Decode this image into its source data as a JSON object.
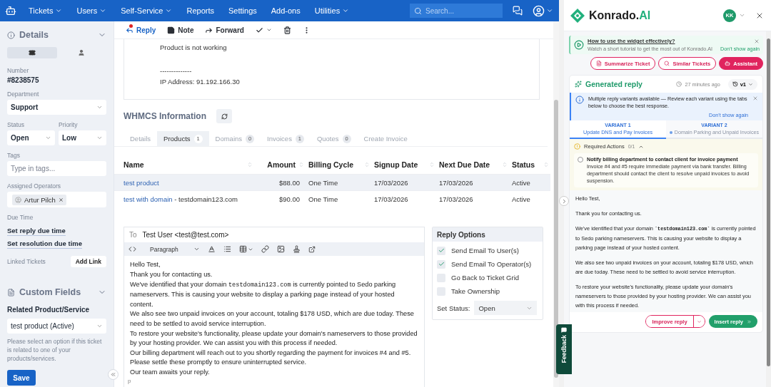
{
  "nav": {
    "items": [
      {
        "label": "Tickets",
        "dropdown": true
      },
      {
        "label": "Users",
        "dropdown": true
      },
      {
        "label": "Self-Service",
        "dropdown": true
      },
      {
        "label": "Reports",
        "dropdown": false
      },
      {
        "label": "Settings",
        "dropdown": false
      },
      {
        "label": "Add-ons",
        "dropdown": false
      },
      {
        "label": "Utilities",
        "dropdown": true
      }
    ],
    "search": {
      "placeholder": "Search..."
    }
  },
  "sidebar": {
    "details": {
      "title": "Details",
      "view_tabs": [
        {
          "kind": "ticket",
          "selected": true
        },
        {
          "kind": "user",
          "selected": false
        }
      ],
      "number_label": "Number",
      "number": "#8238575",
      "department_label": "Department",
      "department": "Support",
      "status_label": "Status",
      "status": "Open",
      "priority_label": "Priority",
      "priority": "Low",
      "tags_label": "Tags",
      "tags_placeholder": "Type in tags...",
      "operators_label": "Assigned Operators",
      "operators": [
        "Artur Pilch"
      ],
      "due_label": "Due Time",
      "due_links": [
        "Set reply due time",
        "Set resolution due time"
      ],
      "linked_label": "Linked Tickets",
      "add_link": "Add Link"
    },
    "custom": {
      "title": "Custom Fields",
      "field_label": "Related Product/Service",
      "field_value": "test product (Active)",
      "help": "Please select an option if this ticket is related to one of your products/services.",
      "save": "Save"
    }
  },
  "toolbar": [
    {
      "kind": "reply",
      "label": "Reply",
      "selected": true,
      "badge_dot": true
    },
    {
      "kind": "note",
      "label": "Note",
      "selected": false,
      "badge_dot": false
    },
    {
      "kind": "forward",
      "label": "Forward",
      "selected": false,
      "badge_dot": false
    },
    {
      "kind": "resolve",
      "selected": false,
      "badge_dot": false
    },
    {
      "kind": "delete",
      "selected": false,
      "badge_dot": false
    },
    {
      "kind": "more",
      "selected": false,
      "badge_dot": false
    }
  ],
  "message": {
    "blocks": [
      [
        "Product is not working"
      ],
      [
        "--------------",
        "IP Address: 91.192.166.30"
      ]
    ]
  },
  "whmcs": {
    "title": "WHMCS Information",
    "tabs": [
      {
        "label": "Details",
        "selected": false
      },
      {
        "label": "Products",
        "count": "1",
        "selected": true
      },
      {
        "label": "Domains",
        "count": "0",
        "selected": false
      },
      {
        "label": "Invoices",
        "count": "1",
        "selected": false
      },
      {
        "label": "Quotes",
        "count": "0",
        "selected": false
      },
      {
        "label": "Create Invoice",
        "selected": false
      }
    ],
    "table": {
      "columns": [
        "Name",
        "Amount",
        "Billing Cycle",
        "Signup Date",
        "Next Due Date",
        "Status"
      ],
      "rows": [
        {
          "name": "test product",
          "amount": "$88.00",
          "billing_cycle": "One Time",
          "signup_date": "17/03/2026",
          "next_due_date": "17/03/2026",
          "status": "Active",
          "selected": true
        },
        {
          "name": "test with domain",
          "domain": "- testdomain123.com",
          "amount": "$90.00",
          "billing_cycle": "One Time",
          "signup_date": "17/03/2026",
          "next_due_date": "17/03/2026",
          "status": "Active",
          "selected": false
        }
      ]
    }
  },
  "editor": {
    "to_label": "To",
    "to": "Test User <test@test.com>",
    "format": "Paragraph",
    "paragraphs": [
      "Hello Test,",
      "Thank you for contacting us.",
      [
        {
          "kind": "text",
          "text": "We've identified that your domain "
        },
        {
          "kind": "code",
          "text": "testdomain123.com"
        },
        {
          "kind": "text",
          "text": " is currently pointed to Sedo parking nameservers. This is causing your website to display a parking page instead of your hosted content."
        }
      ],
      "We also see two unpaid invoices on your account, totaling $178 USD, which are due today. These need to be settled to avoid service interruption.",
      "To restore your website's functionality, please update your domain's nameservers to those provided by your hosting provider. We can assist you with this process if needed.",
      "Our billing department will reach out to you shortly regarding the payment for invoices #4 and #5. Please settle these promptly to ensure uninterrupted service.",
      "Our team awaits your reply."
    ],
    "path": "p"
  },
  "reply_options": {
    "title": "Reply Options",
    "options": [
      {
        "label": "Send Email To User(s)",
        "checked": true
      },
      {
        "label": "Send Email To Operator(s)",
        "checked": true
      },
      {
        "label": "Go Back to Ticket Grid",
        "checked": false
      },
      {
        "label": "Take Ownership",
        "checked": false
      }
    ],
    "status_label": "Set Status:",
    "status": "Open"
  },
  "assistant": {
    "brand": "Konrado.",
    "brand_accent": "AI",
    "avatar": "KK",
    "tip": {
      "title": "How to use the widget effectively?",
      "text": "Watch a short tutorial to get the most out of Konrado.AI",
      "dismiss": "Don't show again"
    },
    "actions": [
      {
        "kind": "summarize",
        "label": "Summarize Ticket",
        "primary": false
      },
      {
        "kind": "similar",
        "label": "Similar Tickets",
        "primary": false
      },
      {
        "kind": "assistant",
        "label": "Assistant",
        "primary": true
      }
    ],
    "generated": {
      "title": "Generated reply",
      "time": "27 minutes ago",
      "version": "v1",
      "notice": {
        "text": "Multiple reply variants available — Review each variant using the tabs below to choose the best response.",
        "dismiss": "Don't show again"
      },
      "variants": [
        {
          "label": "VARIANT 1",
          "title": "Update DNS and Pay Invoices",
          "selected": true,
          "unseen": false
        },
        {
          "label": "VARIANT 2",
          "title": "Domain Parking and Unpaid Invoices",
          "selected": false,
          "unseen": true
        }
      ],
      "required": {
        "title": "Required Actions",
        "count": "0/1",
        "expanded": true,
        "items": [
          {
            "title": "Notify billing department to contact client for invoice payment",
            "text": "Invoice #4 and #5 require immediate payment via bank transfer. Billing department should contact the client to resolve unpaid invoices to avoid suspension.",
            "checked": false
          }
        ]
      },
      "reply": [
        "Hello Test,",
        "Thank you for contacting us.",
        [
          {
            "kind": "text",
            "text": "We've identified that your domain "
          },
          {
            "kind": "code",
            "text": "`testdomain123.com`"
          },
          {
            "kind": "text",
            "text": " is currently pointed to Sedo parking nameservers. This is causing your website to display a parking page instead of your hosted content."
          }
        ],
        "We also see two unpaid invoices on your account, totaling $178 USD, which are due today. These need to be settled to avoid service interruption.",
        "To restore your website's functionality, please update your domain's nameservers to those provided by your hosting provider. We can assist you with this process if needed."
      ],
      "improve": "Improve reply",
      "insert": "Insert reply"
    }
  },
  "feedback": "Feedback"
}
